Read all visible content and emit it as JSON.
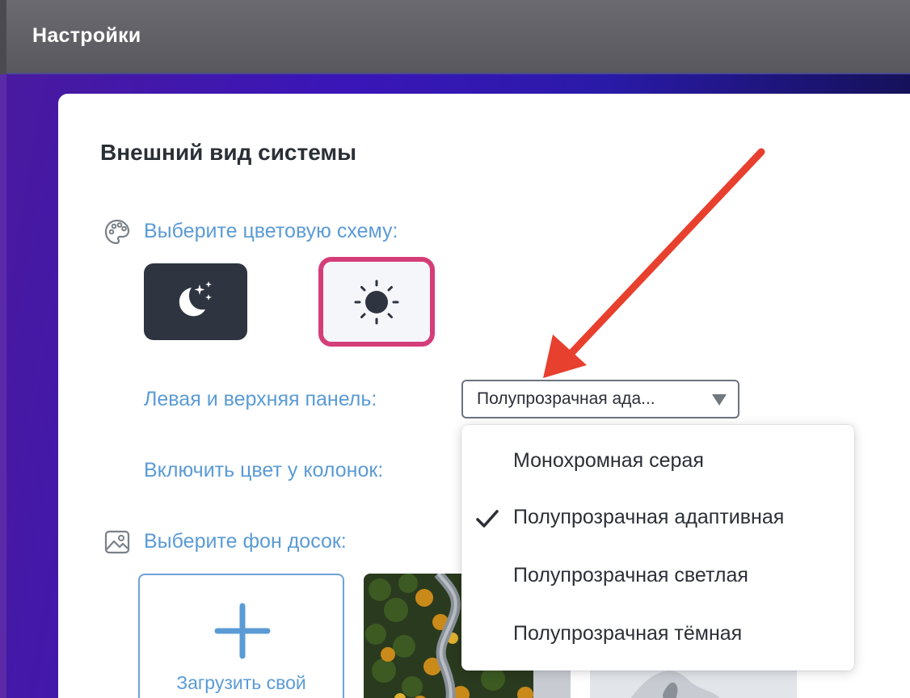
{
  "window": {
    "title": "Настройки"
  },
  "appearance": {
    "section_title": "Внешний вид системы",
    "color_scheme_label": "Выберите цветовую схему:",
    "themes": [
      {
        "name": "dark",
        "icon": "moon-stars-icon",
        "selected": false
      },
      {
        "name": "light",
        "icon": "sun-icon",
        "selected": true
      }
    ],
    "panel_label": "Левая и верхняя панель:",
    "panel_select_value": "Полупрозрачная ада...",
    "columns_label": "Включить цвет у колонок:",
    "board_bg_label": "Выберите фон досок:",
    "upload_label": "Загрузить свой"
  },
  "dropdown": {
    "options": [
      {
        "label": "Монохромная серая",
        "checked": false
      },
      {
        "label": "Полупрозрачная адаптивная",
        "checked": true
      },
      {
        "label": "Полупрозрачная светлая",
        "checked": false
      },
      {
        "label": "Полупрозрачная тёмная",
        "checked": false
      }
    ]
  },
  "colors": {
    "accent_blue": "#5b9bd5",
    "selected_border": "#d43d78",
    "dark_theme_bg": "#2e3440",
    "annotation_arrow": "#e8402e"
  }
}
